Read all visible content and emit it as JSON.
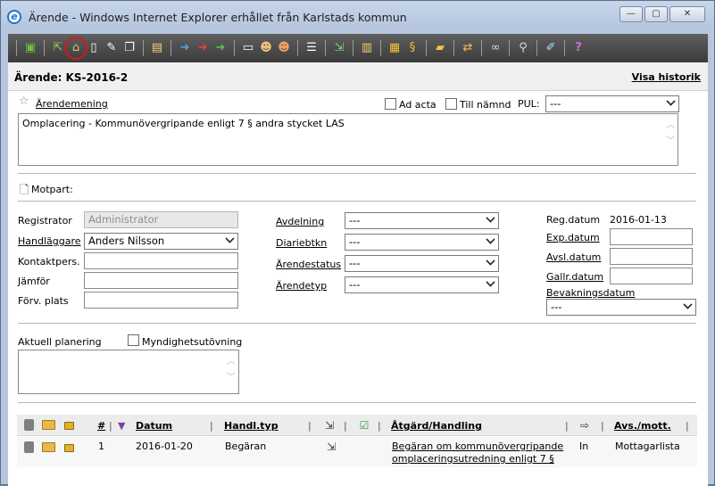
{
  "window": {
    "title": "Ärende - Windows Internet Explorer erhållet från Karlstads kommun",
    "icon": "ie-logo-icon",
    "controls": [
      "minimize-icon",
      "maximize-icon",
      "close-icon"
    ]
  },
  "toolbar": {
    "icons": [
      "save-icon",
      "new-case-icon",
      "open-case-icon",
      "document-icon",
      "edit-document-icon",
      "copy-document-icon",
      "clipboard-icon",
      "arrow-right-blue-icon",
      "arrow-right-red-icon",
      "arrow-right-green-icon",
      "id-card-icon",
      "person-icon",
      "persons-icon",
      "list-icon",
      "export-icon",
      "window-icon",
      "lock-icon",
      "paragraph-icon",
      "folders-icon",
      "move-icon",
      "link-icon",
      "search-icon",
      "tools-icon",
      "help-icon"
    ],
    "highlighted_icon": "open-case-icon"
  },
  "case": {
    "title": "Ärende: KS-2016-2",
    "history_link": "Visa historik"
  },
  "subject": {
    "label": "Ärendemening",
    "text": "Omplacering - Kommunövergripande enligt 7 § andra stycket LAS"
  },
  "flags": {
    "ad_acta": "Ad acta",
    "till_namnd": "Till nämnd",
    "pul_label": "PUL:",
    "pul_value": "---"
  },
  "counterpart": {
    "label": "Motpart:"
  },
  "left_fields": {
    "registrator_label": "Registrator",
    "registrator_value": "Administrator",
    "handlaggare_label": "Handläggare",
    "handlaggare_value": "Anders Nilsson",
    "kontaktpers_label": "Kontaktpers.",
    "jamfor_label": "Jämför",
    "forv_plats_label": "Förv. plats"
  },
  "mid_fields": {
    "avdelning_label": "Avdelning",
    "avdelning_value": "---",
    "diariebtkn_label": "Diariebtkn",
    "diariebtkn_value": "---",
    "arendestatus_label": "Ärendestatus",
    "arendestatus_value": "---",
    "arendetyp_label": "Ärendetyp",
    "arendetyp_value": "---"
  },
  "right_fields": {
    "regdatum_label": "Reg.datum",
    "regdatum_value": "2016-01-13",
    "expdatum_label": "Exp.datum",
    "avsldatum_label": "Avsl.datum",
    "gallrdatum_label": "Gallr.datum",
    "bevakning_label": "Bevakningsdatum",
    "bevakning_value": "---"
  },
  "planning": {
    "label": "Aktuell planering",
    "myndighet_label": "Myndighetsutövning"
  },
  "grid": {
    "columns": [
      "#",
      "Datum",
      "Handl.typ",
      "Åtgärd/Handling",
      "In",
      "Avs./mott."
    ],
    "rows": [
      {
        "nr": "1",
        "datum": "2016-01-20",
        "handl_typ": "Begäran",
        "atgard_line1": "Begäran om kommunövergripande",
        "atgard_line2": "omplaceringsutredning enligt 7 §",
        "riktning": "In",
        "avs_mott": "Mottagarlista"
      }
    ]
  },
  "colors": {
    "toolbar_bg": "#3b3b3b",
    "window_frame": "#b5c6de",
    "highlight_circle": "#d21a1a"
  }
}
